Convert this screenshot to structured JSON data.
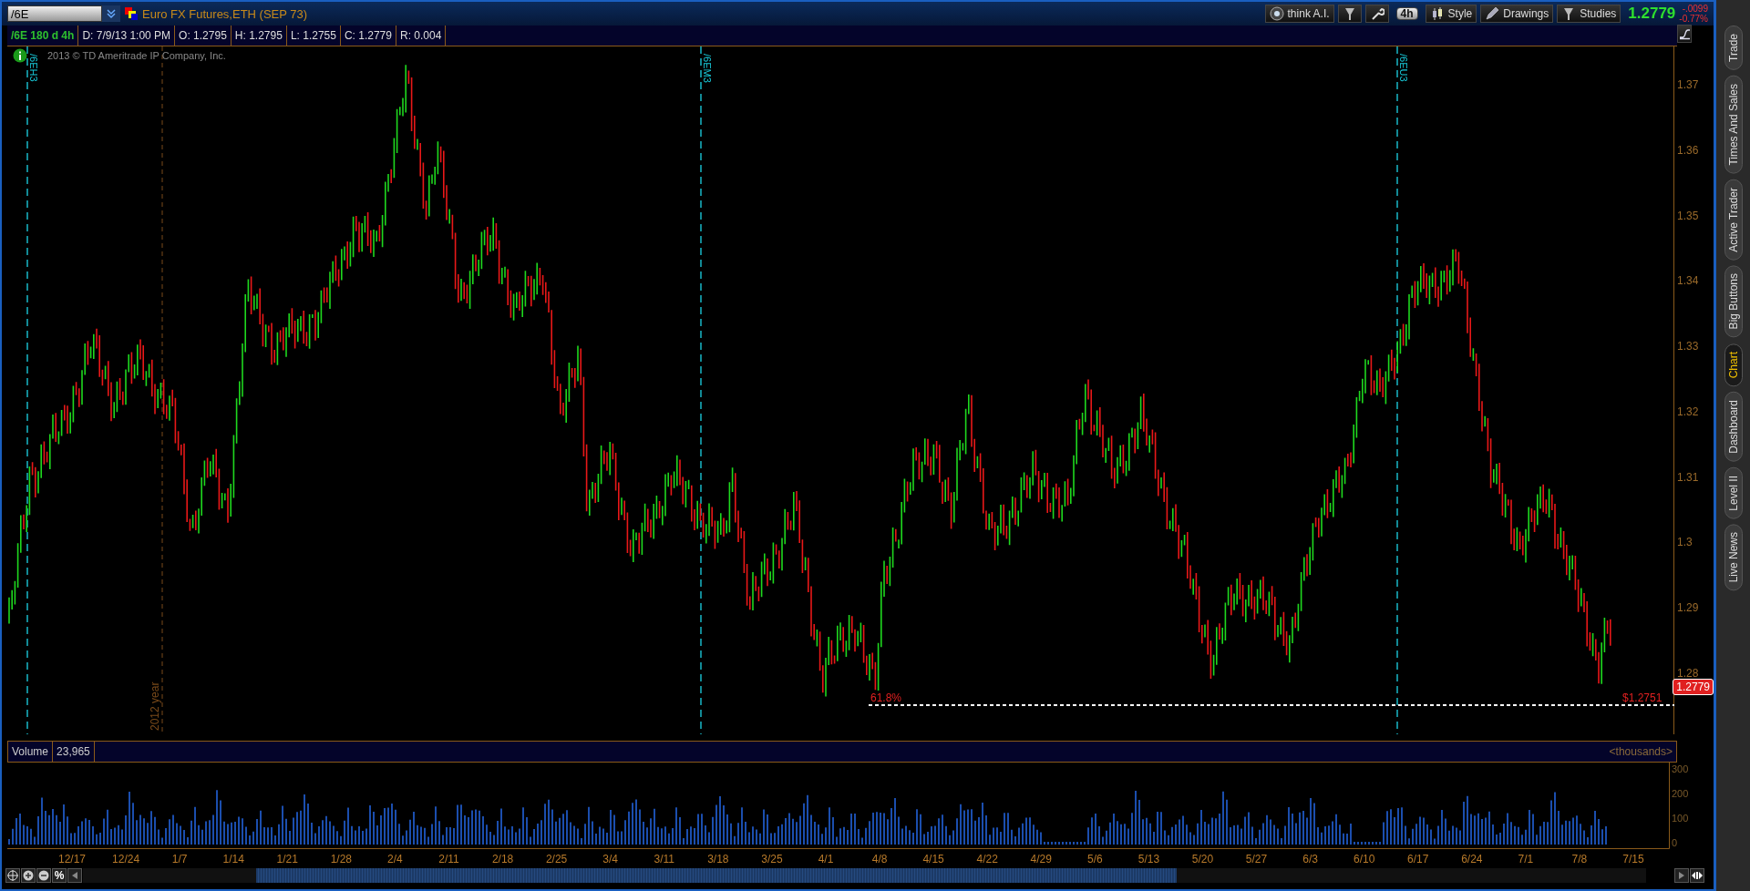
{
  "toolbar": {
    "symbol": "/6E",
    "description": "Euro FX Futures,ETH (SEP 73)",
    "buttons": [
      {
        "kind": "ai",
        "label": "think A.I."
      },
      {
        "kind": "period",
        "label": "4h"
      },
      {
        "kind": "style",
        "label": "Style"
      },
      {
        "kind": "drawings",
        "label": "Drawings"
      },
      {
        "kind": "studies",
        "label": "Studies"
      }
    ],
    "last": "1.2779",
    "change": "-.0099",
    "change_pct": "-0.77%"
  },
  "info_bar": {
    "study": "/6E 180 d 4h",
    "fields": [
      "D: 7/9/13 1:00 PM",
      "O: 1.2795",
      "H: 1.2795",
      "L: 1.2755",
      "C: 1.2779",
      "R: 0.004"
    ]
  },
  "chart": {
    "copyright": "2013 © TD Ameritrade IP Company, Inc.",
    "markers": [
      {
        "kind": "expiry",
        "label": "/6EH3"
      },
      {
        "kind": "year",
        "label": "2012 year"
      },
      {
        "kind": "expiry",
        "label": "/6EM3"
      },
      {
        "kind": "expiry",
        "label": "/6EU3"
      }
    ],
    "fib_label": "61.8%",
    "fib_price": "$1.2751",
    "price_ticks": [
      "1.37",
      "1.36",
      "1.35",
      "1.34",
      "1.33",
      "1.32",
      "1.31",
      "1.3",
      "1.29",
      "1.28"
    ],
    "last_price": "1.2779"
  },
  "volume": {
    "title": "Volume",
    "value": "23,965",
    "units": "<thousands>",
    "ticks": [
      "300",
      "200",
      "100",
      "0"
    ]
  },
  "dates": [
    "12/17",
    "12/24",
    "1/7",
    "1/14",
    "1/21",
    "1/28",
    "2/4",
    "2/11",
    "2/18",
    "2/25",
    "3/4",
    "3/11",
    "3/18",
    "3/25",
    "4/1",
    "4/8",
    "4/15",
    "4/22",
    "4/29",
    "5/6",
    "5/13",
    "5/20",
    "5/27",
    "6/3",
    "6/10",
    "6/17",
    "6/24",
    "7/1",
    "7/8",
    "7/15"
  ],
  "scroll": {
    "percent": "%"
  },
  "side_tabs": [
    {
      "label": "Trade",
      "selected": false
    },
    {
      "label": "Times And Sales",
      "selected": false
    },
    {
      "label": "Active Trader",
      "selected": false
    },
    {
      "label": "Big Buttons",
      "selected": false
    },
    {
      "label": "Chart",
      "selected": true
    },
    {
      "label": "Dashboard",
      "selected": false
    },
    {
      "label": "Level II",
      "selected": false
    },
    {
      "label": "Live News",
      "selected": false
    }
  ]
}
